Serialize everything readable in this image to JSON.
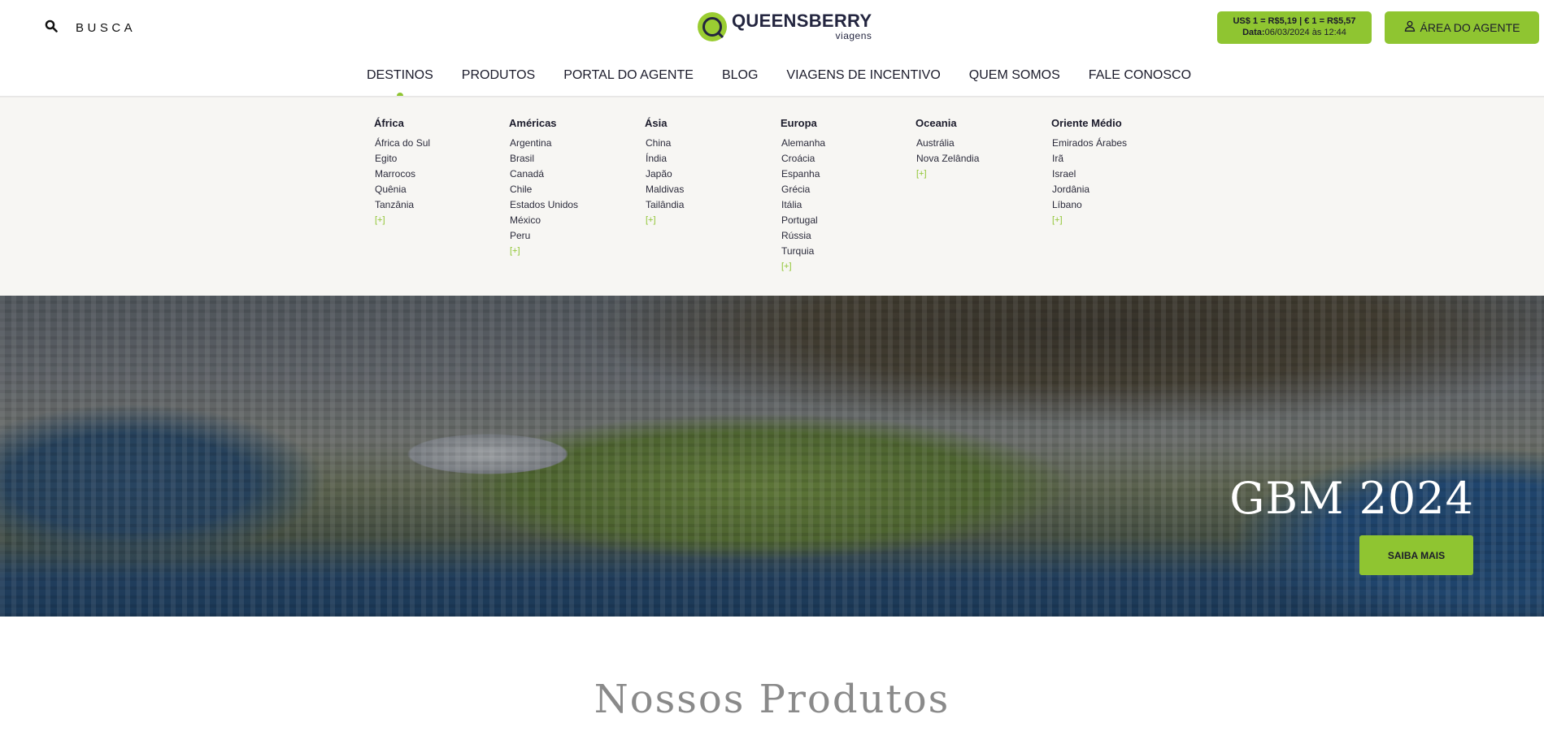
{
  "header": {
    "search_label": "BUSCA",
    "logo_name": "QUEENSBERRY",
    "logo_sub": "viagens",
    "rates_line": "US$ 1 = R$5,19 | € 1 = R$5,57",
    "rates_date_label": "Data:",
    "rates_date_value": "06/03/2024 às 12:44",
    "agent_button": "ÁREA DO AGENTE"
  },
  "nav": {
    "items": [
      {
        "label": "DESTINOS",
        "active": true
      },
      {
        "label": "PRODUTOS"
      },
      {
        "label": "PORTAL DO AGENTE"
      },
      {
        "label": "BLOG"
      },
      {
        "label": "VIAGENS DE INCENTIVO"
      },
      {
        "label": "QUEM SOMOS"
      },
      {
        "label": "FALE CONOSCO"
      }
    ]
  },
  "mega_menu": {
    "columns": [
      {
        "title": "África",
        "items": [
          "África do Sul",
          "Egito",
          "Marrocos",
          "Quênia",
          "Tanzânia"
        ],
        "more": "[+]"
      },
      {
        "title": "Américas",
        "items": [
          "Argentina",
          "Brasil",
          "Canadá",
          "Chile",
          "Estados Unidos",
          "México",
          "Peru"
        ],
        "more": "[+]"
      },
      {
        "title": "Ásia",
        "items": [
          "China",
          "Índia",
          "Japão",
          "Maldivas",
          "Tailândia"
        ],
        "more": "[+]"
      },
      {
        "title": "Europa",
        "items": [
          "Alemanha",
          "Croácia",
          "Espanha",
          "Grécia",
          "Itália",
          "Portugal",
          "Rússia",
          "Turquia"
        ],
        "more": "[+]"
      },
      {
        "title": "Oceania",
        "items": [
          "Austrália",
          "Nova Zelândia"
        ],
        "more": "[+]"
      },
      {
        "title": "Oriente Médio",
        "items": [
          "Emirados Árabes",
          "Irã",
          "Israel",
          "Jordânia",
          "Líbano"
        ],
        "more": "[+]"
      }
    ]
  },
  "hero": {
    "title": "GBM 2024",
    "button": "SAIBA MAIS"
  },
  "products": {
    "title": "Nossos Produtos"
  },
  "colors": {
    "accent": "#8fc531",
    "brand_dark": "#23253f",
    "menu_bg": "#f7f6f3"
  }
}
